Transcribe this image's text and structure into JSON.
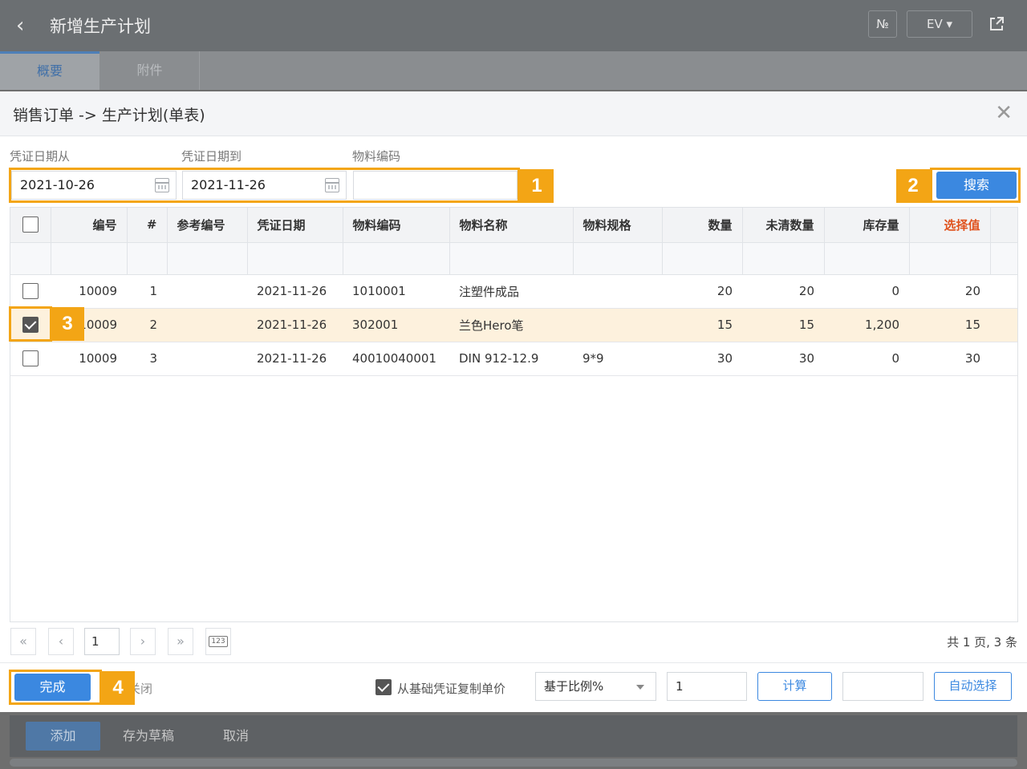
{
  "topbar": {
    "title": "新增生产计划",
    "btn_no": "№",
    "btn_ev": "EV ▾",
    "share_icon": "share-icon"
  },
  "tabs": [
    {
      "label": "概要"
    },
    {
      "label": "附件"
    }
  ],
  "dialog": {
    "title": "销售订单 -> 生产计划(单表)",
    "filters": {
      "date_from_label": "凭证日期从",
      "date_from_value": "2021-10-26",
      "date_to_label": "凭证日期到",
      "date_to_value": "2021-11-26",
      "material_code_label": "物料编码",
      "material_code_value": ""
    },
    "search_label": "搜索",
    "table": {
      "headers": [
        "编号",
        "#",
        "参考编号",
        "凭证日期",
        "物料编码",
        "物料名称",
        "物料规格",
        "数量",
        "未清数量",
        "库存量",
        "选择值"
      ],
      "rows": [
        {
          "checked": false,
          "no": "10009",
          "idx": "1",
          "ref": "",
          "date": "2021-11-26",
          "code": "1010001",
          "name": "注塑件成品",
          "spec": "",
          "qty": "20",
          "open_qty": "20",
          "stock": "0",
          "select": "20"
        },
        {
          "checked": true,
          "no": "10009",
          "idx": "2",
          "ref": "",
          "date": "2021-11-26",
          "code": "302001",
          "name": "兰色Hero笔",
          "spec": "",
          "qty": "15",
          "open_qty": "15",
          "stock": "1,200",
          "select": "15"
        },
        {
          "checked": false,
          "no": "10009",
          "idx": "3",
          "ref": "",
          "date": "2021-11-26",
          "code": "40010040001",
          "name": "DIN 912-12.9",
          "spec": "9*9",
          "qty": "30",
          "open_qty": "30",
          "stock": "0",
          "select": "30"
        }
      ]
    },
    "pager": {
      "first": "«",
      "prev": "‹",
      "page": "1",
      "next": "›",
      "last": "»",
      "jump_icon": "123",
      "info": "共 1 页, 3 条"
    },
    "footer": {
      "done_label": "完成",
      "close_partial": "关闭",
      "copy_price_label": "从基础凭证复制单价",
      "copy_price_checked": true,
      "ratio_select": "基于比例%",
      "ratio_value": "1",
      "calc_label": "计算",
      "calc_result": "",
      "auto_select_label": "自动选择"
    },
    "callouts": [
      "1",
      "2",
      "3",
      "4"
    ]
  },
  "bottombar": {
    "add_label": "添加",
    "draft_label": "存为草稿",
    "cancel_label": "取消"
  }
}
